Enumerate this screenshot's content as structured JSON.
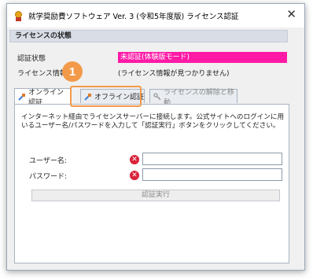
{
  "window": {
    "title": "就学奨励費ソフトウェア Ver. 3 (令和5年度版) ライセンス認証",
    "close_glyph": "✕"
  },
  "license_status": {
    "header": "ライセンスの状態",
    "auth_label": "認証状態",
    "auth_value": "未認証(体験版モード)",
    "info_label": "ライセンス情報",
    "info_value": "(ライセンス情報が見つかりません)",
    "highlight_color": "#ff1aa6"
  },
  "callout": {
    "number": "1",
    "color": "#f29a4a"
  },
  "tabs": [
    {
      "label": "オンライン認証",
      "icon": "plug-icon"
    },
    {
      "label": "オフライン認証",
      "icon": "plug-offline-icon"
    },
    {
      "label": "ライセンスの解除と移動",
      "icon": "key-icon"
    }
  ],
  "online_panel": {
    "description": "インターネット経由でライセンスサーバーに接続します。公式サイトへのログインに用いるユーザー名/パスワードを入力して「認証実行」ボタンをクリックしてください。",
    "username_label": "ユーザー名:",
    "password_label": "パスワード:",
    "username_value": "",
    "password_value": "",
    "error_glyph": "✕",
    "submit_label": "認証実行"
  }
}
